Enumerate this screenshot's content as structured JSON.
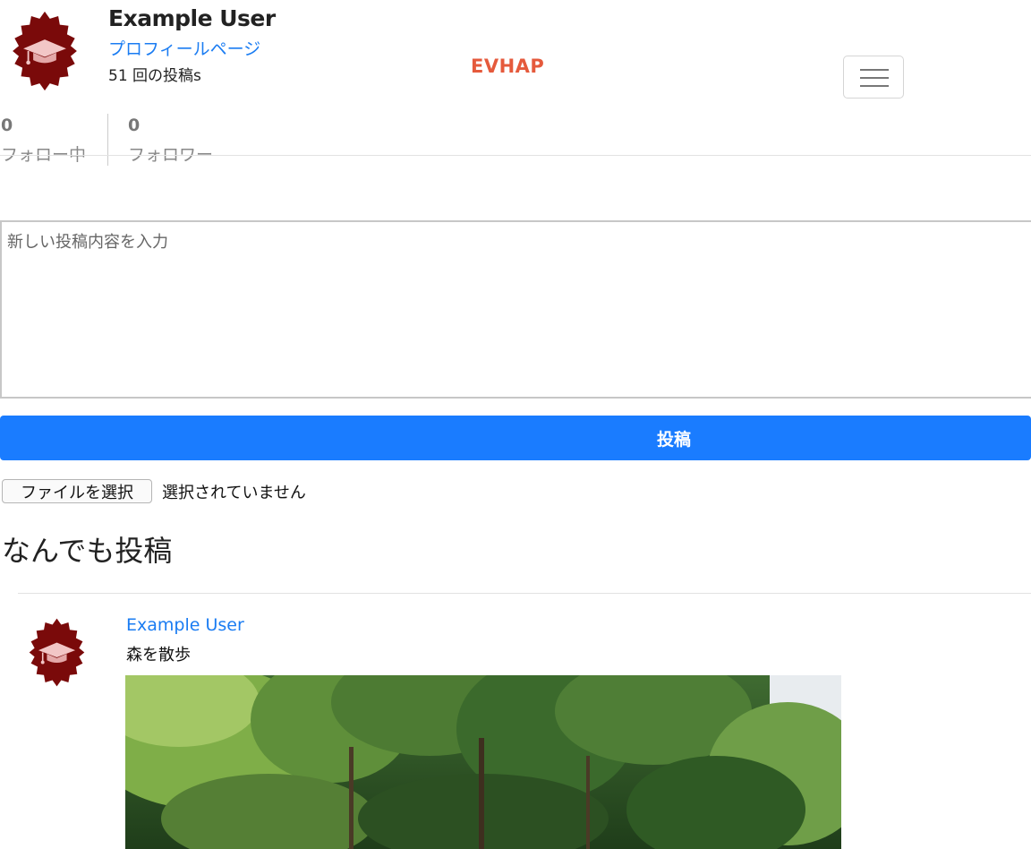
{
  "profile": {
    "name": "Example User",
    "profile_link": "プロフィールページ",
    "post_count": "51 回の投稿s"
  },
  "brand": "EVHAP",
  "nav": {
    "menu_icon": "hamburger-icon"
  },
  "stats": {
    "following_count": "0",
    "following_label": "フォロー中",
    "followers_count": "0",
    "followers_label": "フォロワー"
  },
  "form": {
    "placeholder": "新しい投稿内容を入力",
    "submit_label": "投稿",
    "file_button_label": "ファイルを選択",
    "file_status": "選択されていません"
  },
  "feed": {
    "title": "なんでも投稿",
    "items": [
      {
        "user": "Example User",
        "content": "森を散歩",
        "avatar_icon": "graduation-cap-icon"
      }
    ]
  },
  "colors": {
    "avatar_badge": "#7a0a0a",
    "brand": "#e55a3c",
    "link": "#1a7cf2",
    "primary_button": "#1a7cff"
  }
}
